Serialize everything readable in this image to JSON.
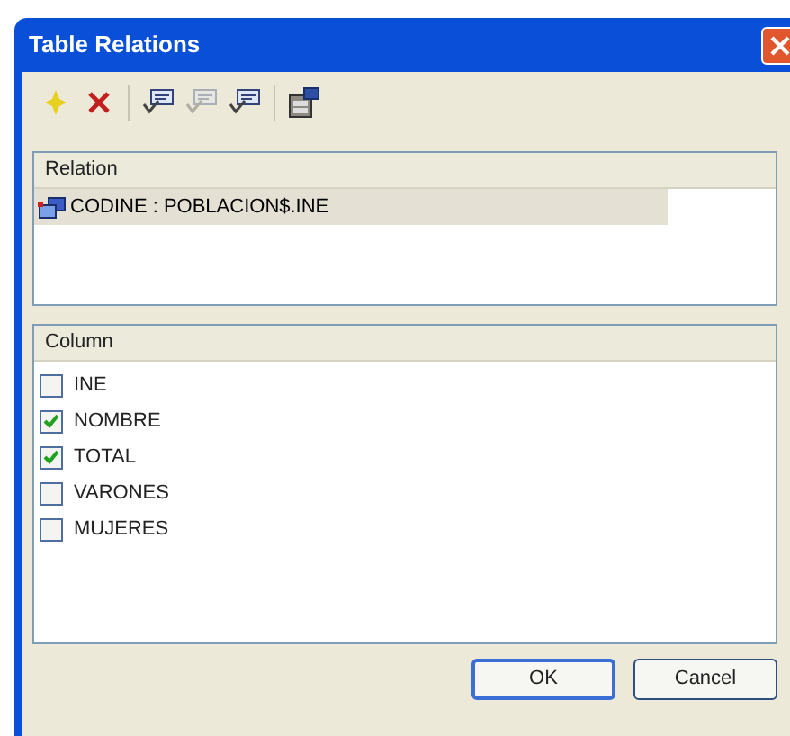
{
  "window": {
    "title": "Table Relations"
  },
  "toolbar": [
    {
      "kind": "add",
      "disabled": false
    },
    {
      "kind": "delete",
      "disabled": false
    },
    {
      "kind": "separator"
    },
    {
      "kind": "relation",
      "disabled": false
    },
    {
      "kind": "relation",
      "disabled": true
    },
    {
      "kind": "relation",
      "disabled": false
    },
    {
      "kind": "separator"
    },
    {
      "kind": "properties",
      "disabled": false
    }
  ],
  "relations": {
    "header": "Relation",
    "rows": [
      {
        "label": "CODINE : POBLACION$.INE",
        "selected": true
      }
    ]
  },
  "columns": {
    "header": "Column",
    "rows": [
      {
        "label": "INE",
        "checked": false
      },
      {
        "label": "NOMBRE",
        "checked": true
      },
      {
        "label": "TOTAL",
        "checked": true
      },
      {
        "label": "VARONES",
        "checked": false
      },
      {
        "label": "MUJERES",
        "checked": false
      }
    ]
  },
  "buttons": [
    "OK",
    "Cancel"
  ]
}
